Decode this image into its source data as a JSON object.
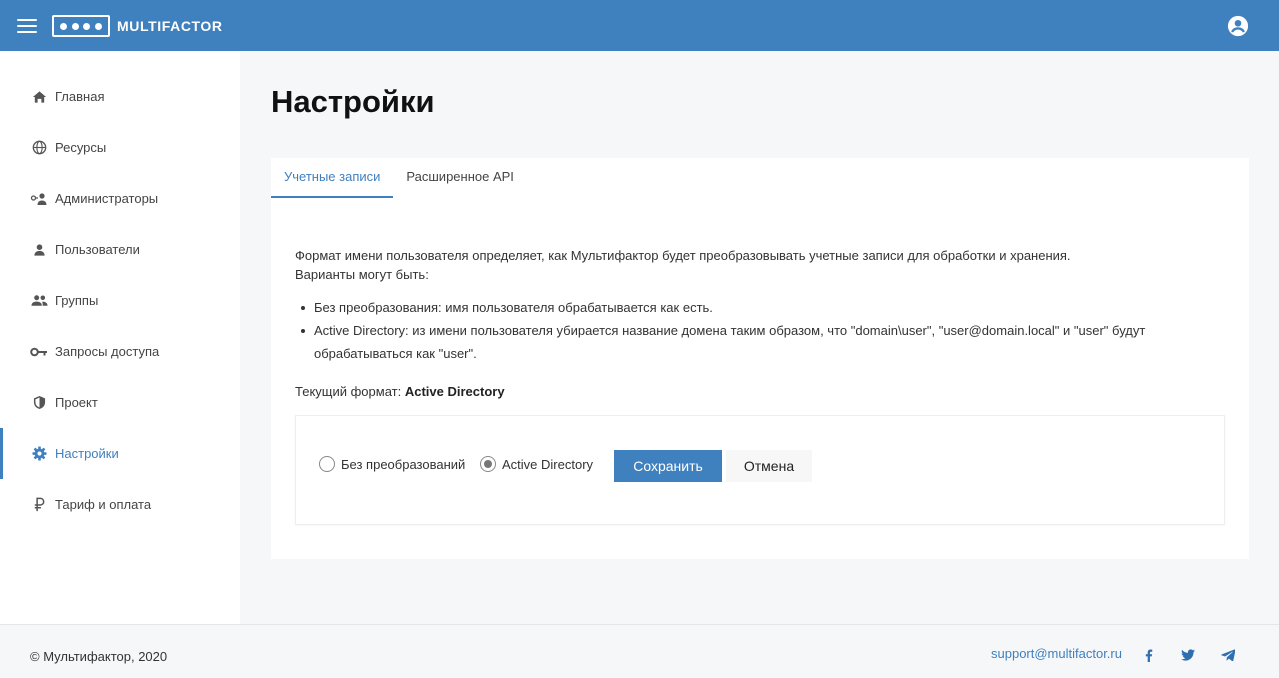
{
  "header": {
    "brand": "MULTIFACTOR"
  },
  "sidebar": {
    "items": [
      {
        "label": "Главная",
        "icon": "home-icon"
      },
      {
        "label": "Ресурсы",
        "icon": "globe-icon"
      },
      {
        "label": "Администраторы",
        "icon": "admins-icon"
      },
      {
        "label": "Пользователи",
        "icon": "person-icon"
      },
      {
        "label": "Группы",
        "icon": "group-icon"
      },
      {
        "label": "Запросы доступа",
        "icon": "key-icon"
      },
      {
        "label": "Проект",
        "icon": "shield-icon"
      },
      {
        "label": "Настройки",
        "icon": "gear-icon",
        "active": true
      },
      {
        "label": "Тариф и оплата",
        "icon": "ruble-icon"
      }
    ]
  },
  "main": {
    "title": "Настройки",
    "tabs": [
      {
        "label": "Учетные записи",
        "active": true
      },
      {
        "label": "Расширенное API",
        "active": false
      }
    ],
    "description_line1": "Формат имени пользователя определяет, как Мультифактор будет преобразовывать учетные записи для обработки и хранения.",
    "description_line2": "Варианты могут быть:",
    "bullets": [
      "Без преобразования: имя пользователя обрабатывается как есть.",
      "Active Directory: из имени пользователя убирается название домена таким образом, что \"domain\\user\", \"user@domain.local\" и \"user\" будут обрабатываться как \"user\"."
    ],
    "current_label": "Текущий формат:",
    "current_value": "Active Directory",
    "options": [
      {
        "label": "Без преобразований",
        "checked": false
      },
      {
        "label": "Active Directory",
        "checked": true
      }
    ],
    "save_label": "Сохранить",
    "cancel_label": "Отмена"
  },
  "footer": {
    "copyright": "© Мультифактор, 2020",
    "support_email": "support@multifactor.ru",
    "social": [
      "facebook-icon",
      "twitter-icon",
      "telegram-icon"
    ]
  },
  "colors": {
    "accent": "#3f80be",
    "background": "#f6f7f9"
  }
}
